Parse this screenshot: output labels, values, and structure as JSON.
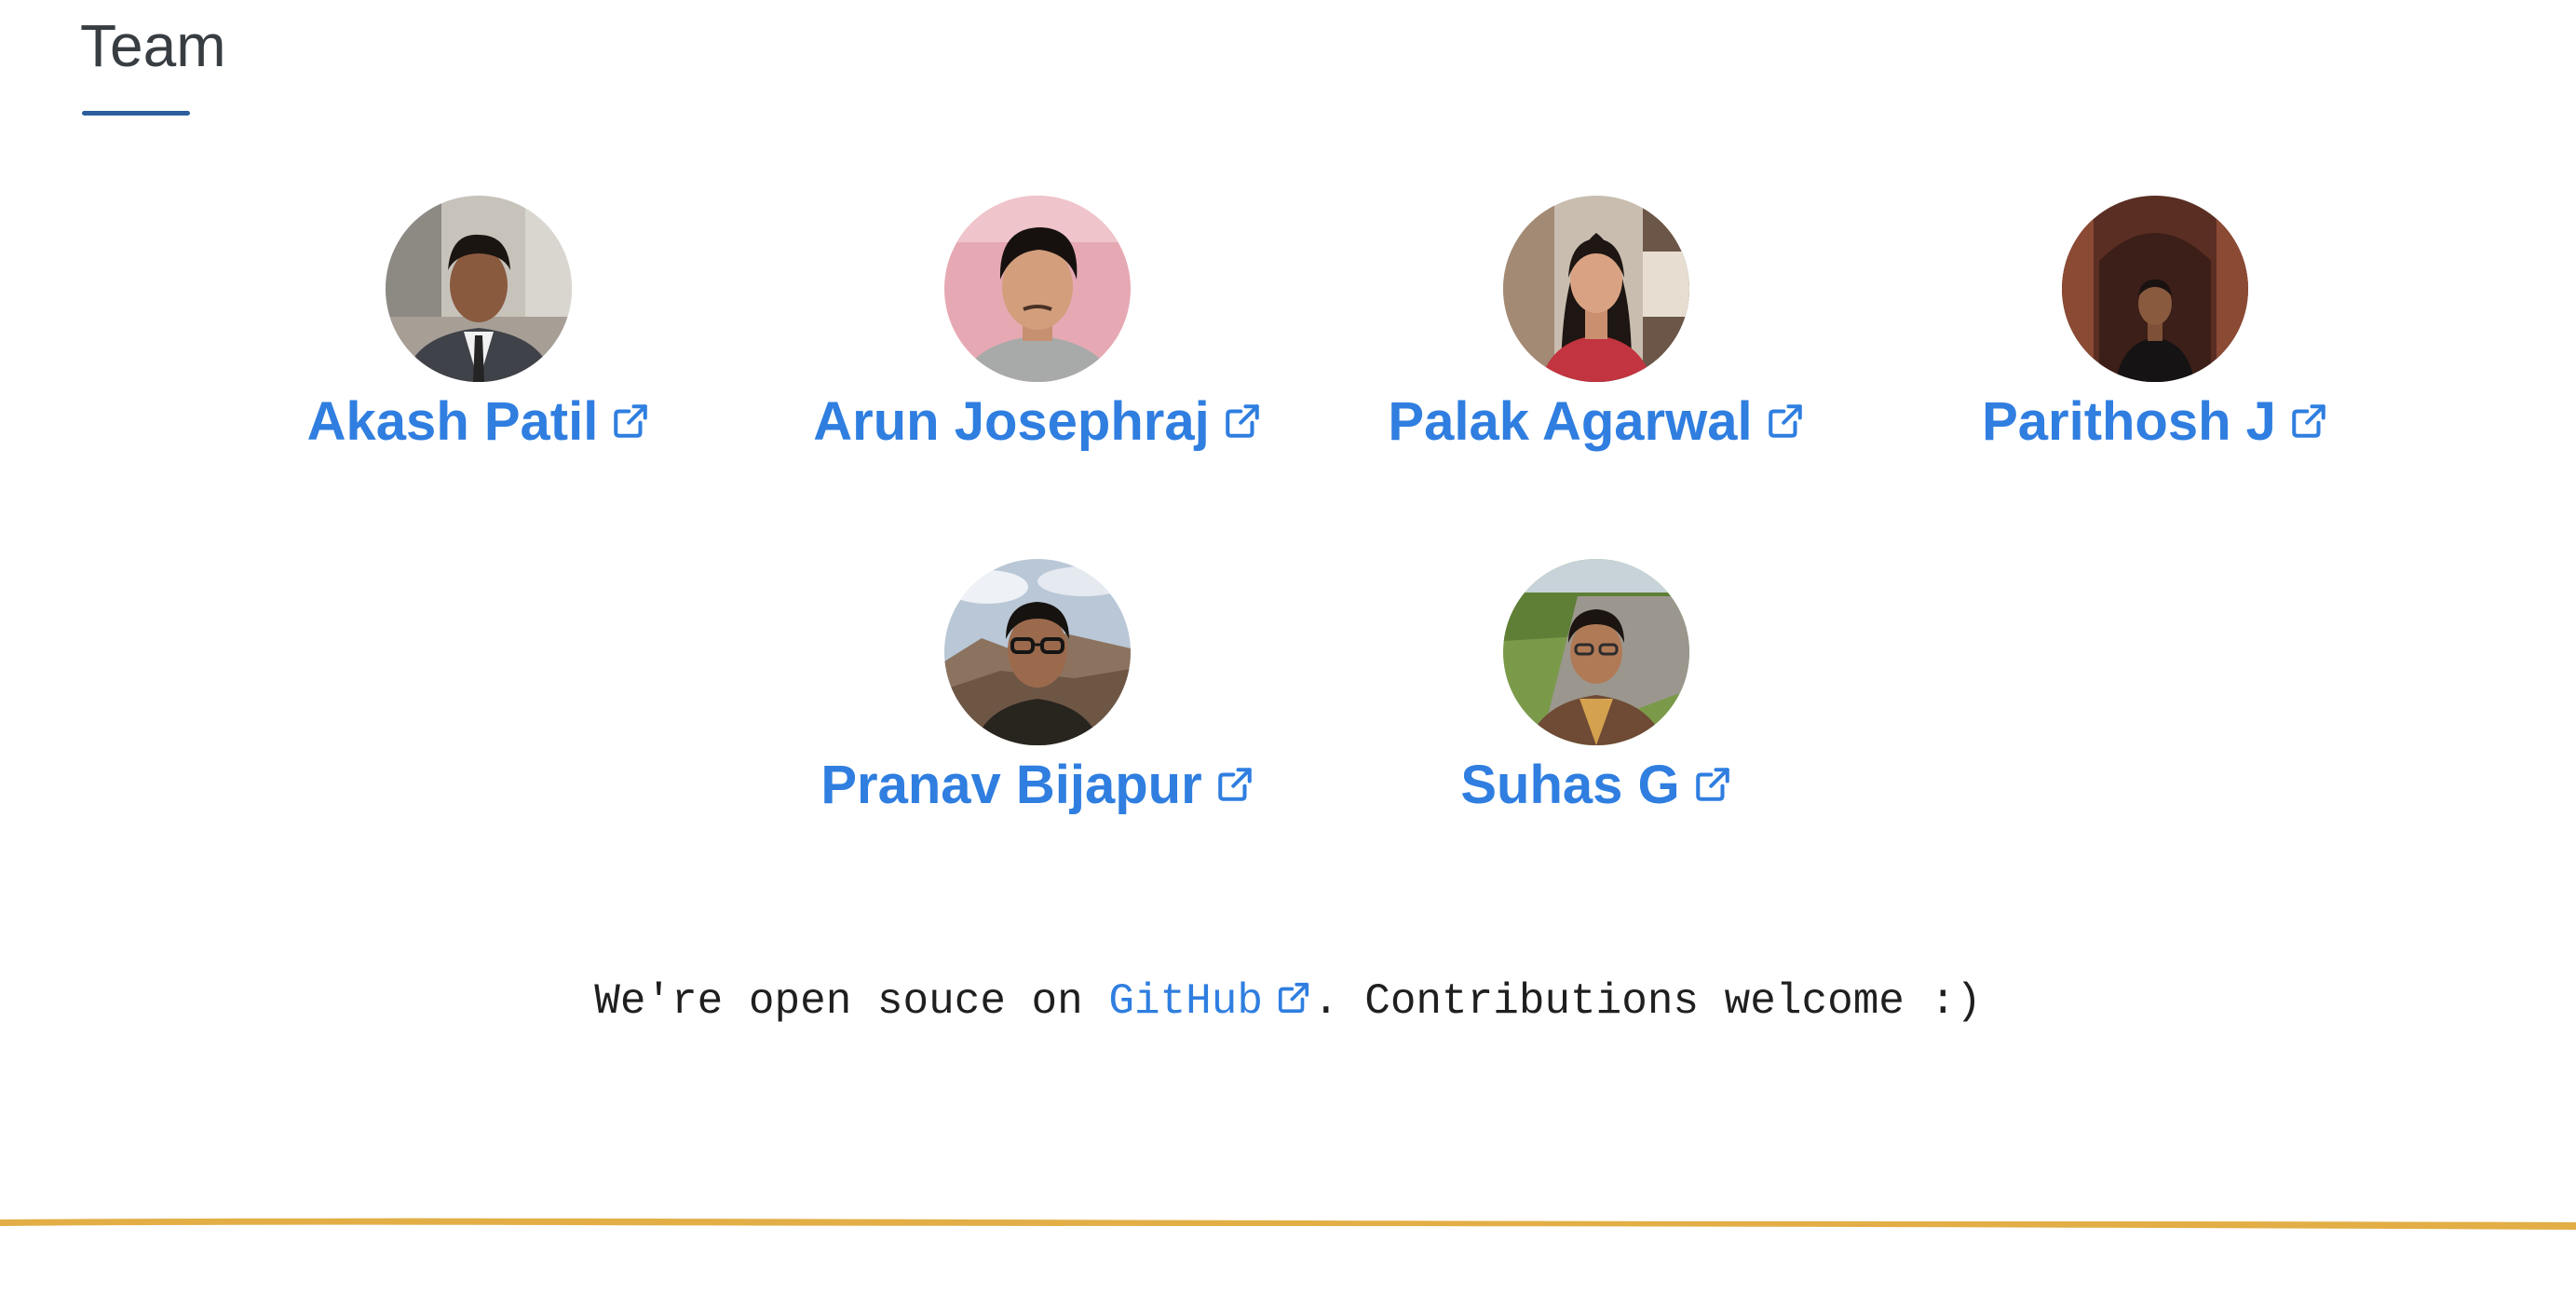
{
  "section": {
    "title": "Team"
  },
  "team": {
    "members": [
      {
        "name": "Akash Patil",
        "avatar_icon": "person-photo-avatar",
        "link_icon": "external-link-icon"
      },
      {
        "name": "Arun Josephraj",
        "avatar_icon": "person-photo-avatar",
        "link_icon": "external-link-icon"
      },
      {
        "name": "Palak Agarwal",
        "avatar_icon": "person-photo-avatar",
        "link_icon": "external-link-icon"
      },
      {
        "name": "Parithosh J",
        "avatar_icon": "person-photo-avatar",
        "link_icon": "external-link-icon"
      },
      {
        "name": "Pranav Bijapur",
        "avatar_icon": "person-photo-avatar",
        "link_icon": "external-link-icon"
      },
      {
        "name": "Suhas G",
        "avatar_icon": "person-photo-avatar",
        "link_icon": "external-link-icon"
      }
    ]
  },
  "open_source": {
    "prefix": "We're open souce on ",
    "link_label": "GitHub",
    "suffix": ". Contributions welcome :)"
  },
  "colors": {
    "link": "#2f7ee0",
    "title_text": "#383d42",
    "title_underline": "#2d5fa0",
    "footer_stroke": "#e2ae45"
  }
}
